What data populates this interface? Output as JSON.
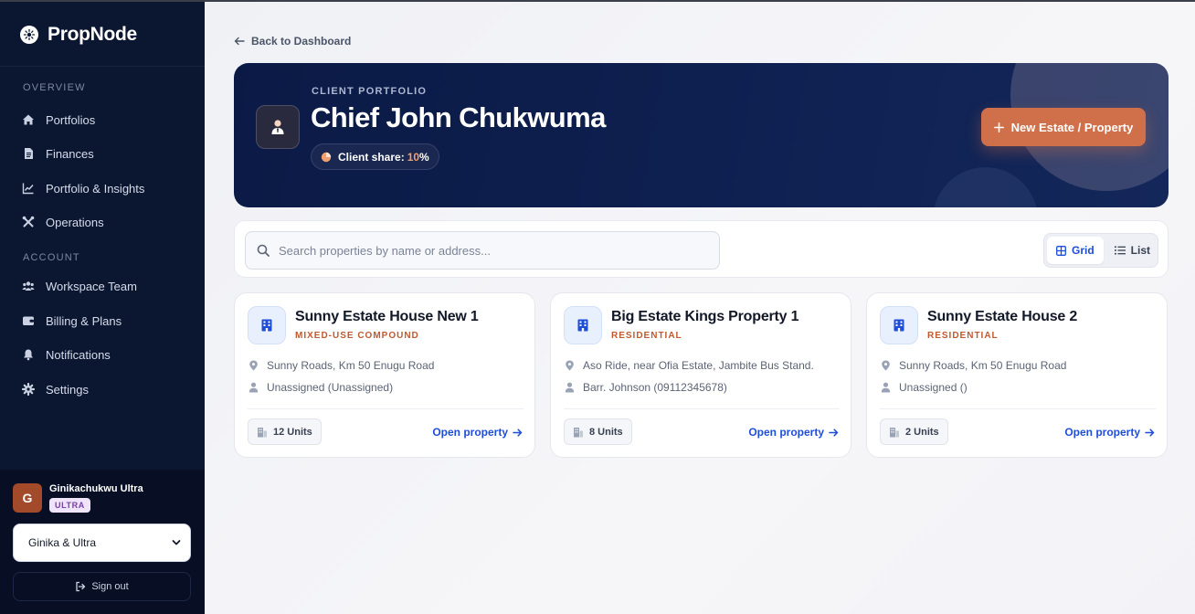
{
  "app": {
    "name": "PropNode",
    "logo_icon": "gear-flower-icon"
  },
  "sidebar": {
    "overview_label": "OVERVIEW",
    "overview_items": [
      {
        "label": "Portfolios",
        "icon": "home-icon"
      },
      {
        "label": "Finances",
        "icon": "document-icon"
      },
      {
        "label": "Portfolio & Insights",
        "icon": "chart-line-icon"
      },
      {
        "label": "Operations",
        "icon": "tools-icon"
      }
    ],
    "account_label": "ACCOUNT",
    "account_items": [
      {
        "label": "Workspace Team",
        "icon": "users-icon"
      },
      {
        "label": "Billing & Plans",
        "icon": "wallet-icon"
      },
      {
        "label": "Notifications",
        "icon": "bell-icon"
      },
      {
        "label": "Settings",
        "icon": "gear-icon"
      }
    ],
    "user": {
      "initial": "G",
      "name": "Ginikachukwu Ultra",
      "plan_badge": "ULTRA"
    },
    "workspace_select": {
      "value": "Ginika & Ultra"
    },
    "signout_label": "Sign out"
  },
  "main": {
    "back_link": "Back to Dashboard",
    "hero": {
      "eyebrow": "CLIENT PORTFOLIO",
      "title": "Chief John Chukwuma",
      "share_label": "Client share:",
      "share_value": "10",
      "share_unit": "%",
      "new_button": "New Estate / Property"
    },
    "search": {
      "placeholder": "Search properties by name or address..."
    },
    "view_toggle": {
      "grid": "Grid",
      "list": "List",
      "active": "grid"
    },
    "properties": [
      {
        "name": "Sunny Estate House New 1",
        "type": "MIXED-USE COMPOUND",
        "address": "Sunny Roads, Km 50 Enugu Road",
        "manager": "Unassigned (Unassigned)",
        "units": "12 Units",
        "link": "Open property"
      },
      {
        "name": "Big Estate Kings Property 1",
        "type": "RESIDENTIAL",
        "address": "Aso Ride, near Ofia Estate, Jambite Bus Stand.",
        "manager": "Barr. Johnson (09112345678)",
        "units": "8 Units",
        "link": "Open property"
      },
      {
        "name": "Sunny Estate House 2",
        "type": "RESIDENTIAL",
        "address": "Sunny Roads, Km 50 Enugu Road",
        "manager": "Unassigned ()",
        "units": "2 Units",
        "link": "Open property"
      }
    ]
  },
  "colors": {
    "sidebar_bg": "#0b1631",
    "accent_orange": "#d0704a",
    "link_blue": "#1e4ed8",
    "hero_bg": "#0b1a45"
  }
}
